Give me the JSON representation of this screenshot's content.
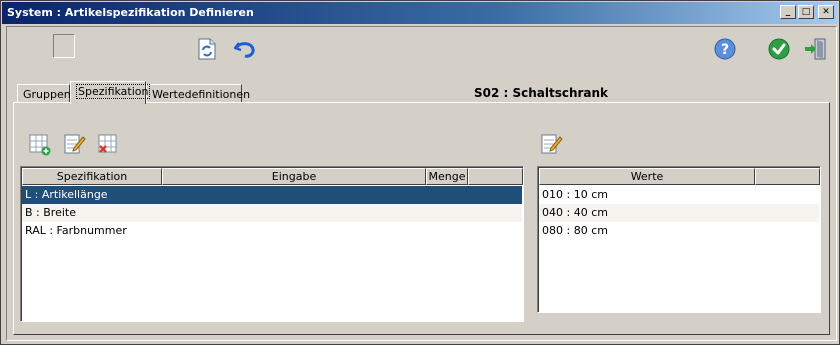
{
  "window": {
    "title": "System : Artikelspezifikation  Definieren",
    "minimize_glyph": "_",
    "maximize_glyph": "□",
    "close_glyph": "✕"
  },
  "toolbar": {
    "left_icons": [
      "refresh-document-icon",
      "undo-icon"
    ],
    "right_icons": [
      "help-icon",
      "ok-check-icon",
      "exit-door-icon"
    ]
  },
  "tabs": {
    "items": [
      {
        "label": "Gruppen"
      },
      {
        "label": "Spezifikation"
      },
      {
        "label": "Wertedefinitionen"
      }
    ],
    "active_index": 1,
    "context_title": "S02 : Schaltschrank"
  },
  "spec_table": {
    "toolbar_icons": [
      "add-row-icon",
      "edit-icon",
      "delete-row-icon"
    ],
    "columns": [
      "Spezifikation",
      "Eingabe",
      "Menge",
      ""
    ],
    "rows": [
      {
        "spezifikation": "L : Artikellänge",
        "eingabe": "",
        "menge": ""
      },
      {
        "spezifikation": "B : Breite",
        "eingabe": "",
        "menge": ""
      },
      {
        "spezifikation": "RAL : Farbnummer",
        "eingabe": "",
        "menge": ""
      }
    ],
    "selected_index": 0
  },
  "values_table": {
    "toolbar_icons": [
      "edit-icon"
    ],
    "columns": [
      "Werte",
      ""
    ],
    "rows": [
      {
        "wert": "010 : 10 cm"
      },
      {
        "wert": "040 : 40 cm"
      },
      {
        "wert": "080 : 80 cm"
      }
    ]
  },
  "colors": {
    "selection": "#1f4e79",
    "titlebar_start": "#0a246a",
    "titlebar_end": "#a6caf0"
  }
}
